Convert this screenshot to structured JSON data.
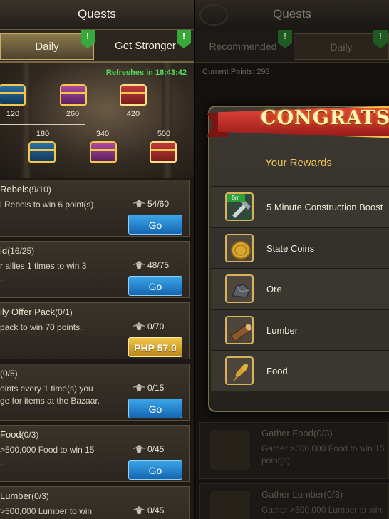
{
  "left": {
    "title": "Quests",
    "tabs": [
      {
        "label": "Daily",
        "active": true,
        "badge": "!"
      },
      {
        "label": "Get Stronger",
        "active": false,
        "badge": "!"
      }
    ],
    "refresh_text": "Refreshes in 18:43:42",
    "milestones_top": [
      "120",
      "260",
      "420"
    ],
    "milestones_bottom": [
      "180",
      "340",
      "500"
    ],
    "quests": [
      {
        "title": "Rebels",
        "count": "(9/10)",
        "desc": "l Rebels to win 6 point(s).",
        "progress": "54/60",
        "button": "Go",
        "button_type": "go"
      },
      {
        "title": "id",
        "count": "(16/25)",
        "desc": "r allies 1 times to win 3\n.",
        "progress": "48/75",
        "button": "Go",
        "button_type": "go"
      },
      {
        "title": "ily Offer Pack",
        "count": "(0/1)",
        "desc": "pack to win 70 points.",
        "progress": "0/70",
        "button": "PHP 57.0",
        "button_type": "buy"
      },
      {
        "title": "",
        "count": "(0/5)",
        "desc": "oints every 1 time(s) you\nge for items at the Bazaar.",
        "progress": "0/15",
        "button": "Go",
        "button_type": "go"
      },
      {
        "title": "Food",
        "count": "(0/3)",
        "desc": ">500,000 Food to win 15\n.",
        "progress": "0/45",
        "button": "Go",
        "button_type": "go"
      },
      {
        "title": "Lumber",
        "count": "(0/3)",
        "desc": ">500,000 Lumber to win",
        "progress": "0/45",
        "button": "Go",
        "button_type": "go"
      }
    ]
  },
  "right": {
    "title": "Quests",
    "tabs": [
      {
        "label": "Recommended",
        "badge": "!"
      },
      {
        "label": "Daily",
        "badge": "!"
      }
    ],
    "current_points": "Current Points: 293",
    "bg_quests": [
      {
        "title": "Gather Food(0/3)",
        "desc": "Gather >500,000 Food to win 15\npoint(s)."
      },
      {
        "title": "Gather Lumber(0/3)",
        "desc": "Gather >500,000 Lumber to win"
      }
    ],
    "modal": {
      "banner": "CONGRATS",
      "subtitle": "Your Rewards",
      "rewards": [
        {
          "name": "5 Minute Construction Boost",
          "icon": "speedup-hammer-icon",
          "badge": "5m"
        },
        {
          "name": "State Coins",
          "icon": "coin-icon"
        },
        {
          "name": "Ore",
          "icon": "ore-icon"
        },
        {
          "name": "Lumber",
          "icon": "lumber-icon"
        },
        {
          "name": "Food",
          "icon": "wheat-icon"
        }
      ]
    }
  },
  "colors": {
    "refresh_green": "#4fe05a",
    "go_blue": "#1f7fd0",
    "buy_gold": "#d9a52e",
    "reward_gold": "#f2c65a"
  }
}
